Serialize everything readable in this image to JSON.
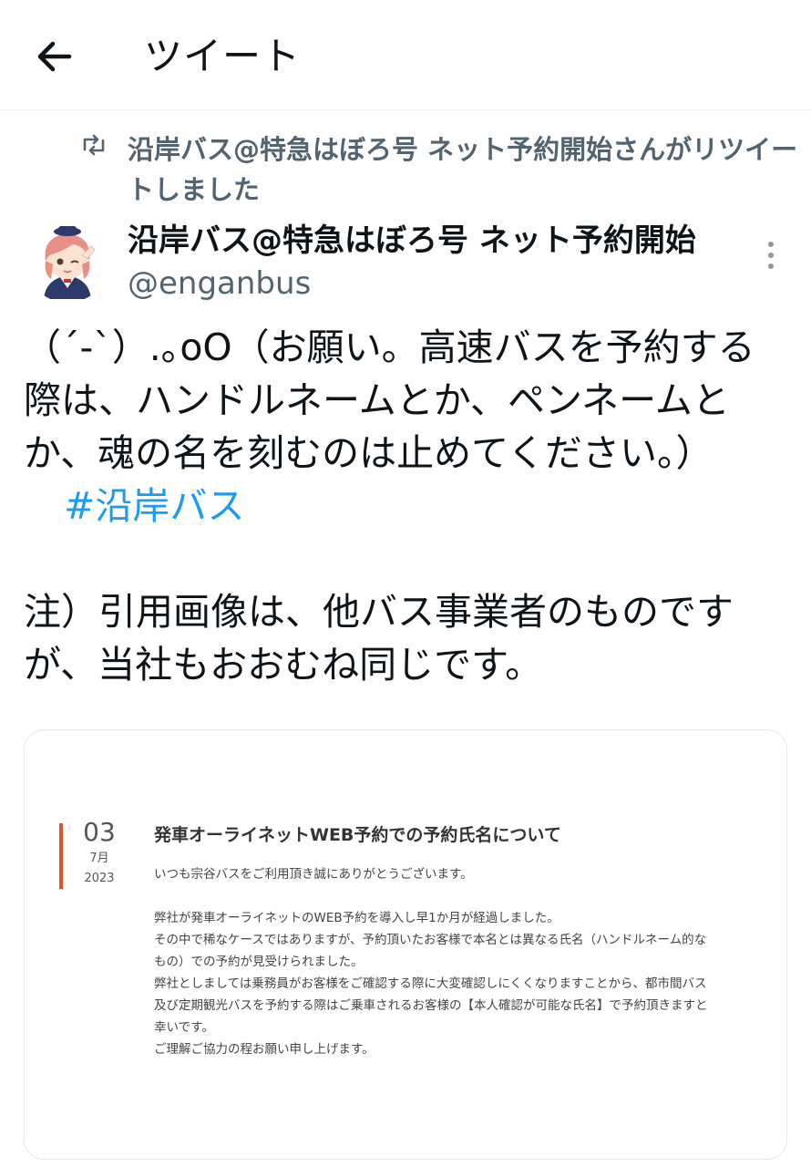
{
  "header": {
    "title": "ツイート"
  },
  "retweet": {
    "text": "沿岸バス@特急はぼろ号 ネット予約開始さんがリツイートしました"
  },
  "author": {
    "name": "沿岸バス@特急はぼろ号 ネット予約開始",
    "handle": "@enganbus"
  },
  "tweet": {
    "lines": [
      "（´-`）.｡oO（お願い。高速バスを予約する",
      "際は、ハンドルネームとか、ペンネームと",
      "か、魂の名を刻むのは止めてください。）"
    ],
    "hashtag": "#沿岸バス",
    "note_lines": [
      "注）引用画像は、他バス事業者のものです",
      "が、当社もおおむね同じです。"
    ]
  },
  "card": {
    "date_day": "03",
    "date_month": "7月",
    "date_year": "2023",
    "title": "発車オーライネットWEB予約での予約氏名について",
    "paragraph1": "いつも宗谷バスをご利用頂き誠にありがとうございます。",
    "lines": [
      "弊社が発車オーライネットのWEB予約を導入し早1か月が経過しました。",
      "その中で稀なケースではありますが、予約頂いたお客様で本名とは異なる氏名（ハンドルネーム的な",
      "もの）での予約が見受けられました。",
      "弊社としましては乗務員がお客様をご確認する際に大変確認しにくくなりますことから、都市間バス",
      "及び定期観光バスを予約する際はご乗車されるお客様の【本人確認が可能な氏名】で予約頂きますと",
      "幸いです。",
      "ご理解ご協力の程お願い申し上げます。"
    ]
  },
  "colors": {
    "text": "#0f1419",
    "secondary": "#536471",
    "link": "#1d9bf0",
    "accent_bar": "#d9582b"
  },
  "icons": {
    "back": "arrow-left-icon",
    "retweet": "retweet-icon",
    "more": "more-vertical-icon"
  }
}
